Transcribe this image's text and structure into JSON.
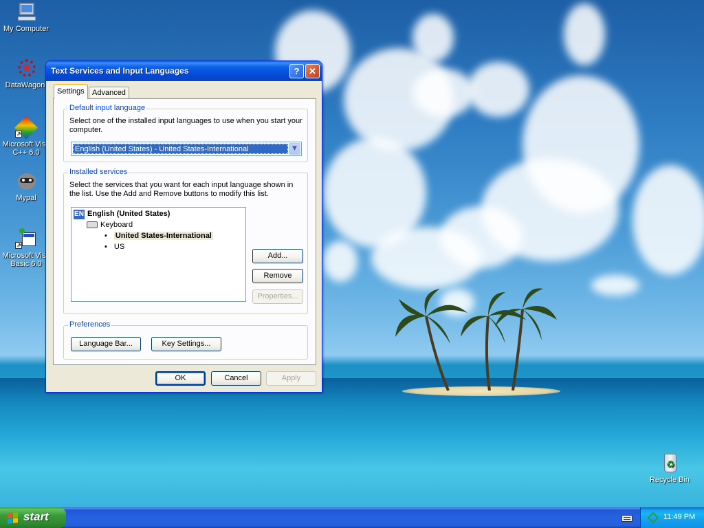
{
  "desktop": {
    "icons": [
      {
        "label_1": "My Computer",
        "label_2": ""
      },
      {
        "label_1": "DataWagon.",
        "label_2": ""
      },
      {
        "label_1": "Microsoft Visu",
        "label_2": "C++ 6.0"
      },
      {
        "label_1": "Mypal",
        "label_2": ""
      },
      {
        "label_1": "Microsoft Visu",
        "label_2": "Basic 6.0"
      },
      {
        "label_1": "Recycle Bin",
        "label_2": ""
      }
    ]
  },
  "dialog": {
    "title": "Text Services and Input Languages",
    "help_label": "?",
    "close_label": "✕",
    "tabs": [
      {
        "label": "Settings",
        "active": true
      },
      {
        "label": "Advanced",
        "active": false
      }
    ],
    "default_language": {
      "legend": "Default input language",
      "description": "Select one of the installed input languages to use when you start your computer.",
      "selected": "English (United States) - United States-International"
    },
    "installed_services": {
      "legend": "Installed services",
      "description": "Select the services that you want for each input language shown in the list. Use the Add and Remove buttons to modify this list.",
      "tree": {
        "badge": "EN",
        "language": "English (United States)",
        "category": "Keyboard",
        "items": [
          "United States-International",
          "US"
        ]
      },
      "buttons": {
        "add": "Add...",
        "remove": "Remove",
        "properties": "Properties..."
      }
    },
    "preferences": {
      "legend": "Preferences",
      "buttons": {
        "language_bar": "Language Bar...",
        "key_settings": "Key Settings..."
      }
    },
    "footer": {
      "ok": "OK",
      "cancel": "Cancel",
      "apply": "Apply"
    }
  },
  "taskbar": {
    "start_label": "start",
    "clock": "11:49 PM"
  },
  "colors": {
    "title_bar": "#0a5fe8",
    "dialog_bg": "#ece9d8",
    "selection": "#316ac5",
    "group_legend": "#0046d5",
    "start_green": "#3a9a3a"
  }
}
